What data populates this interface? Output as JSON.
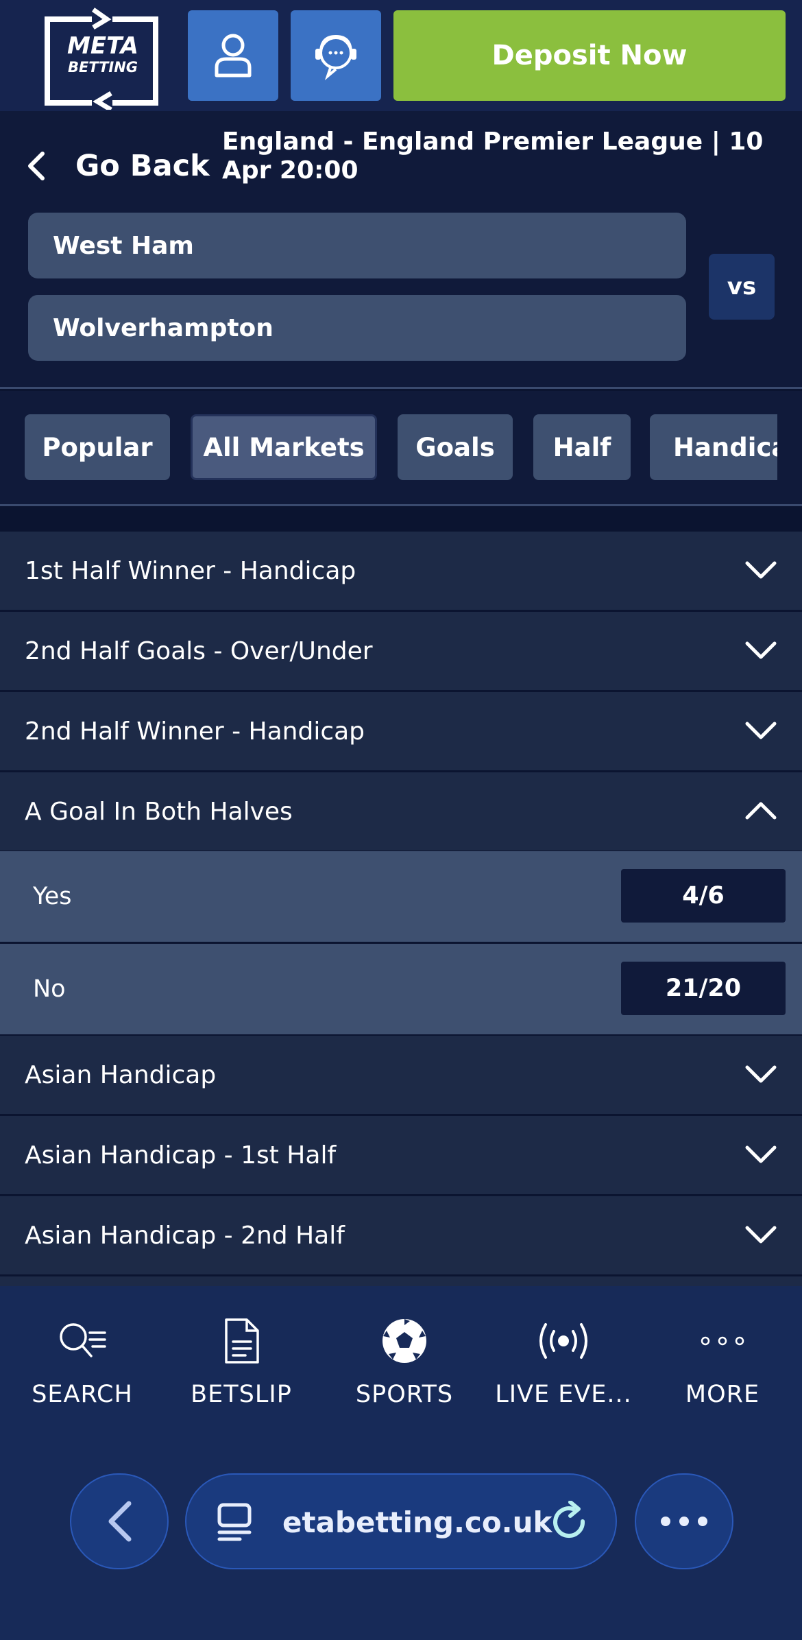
{
  "header": {
    "logo_line1": "META",
    "logo_line2": "BETTING",
    "user_icon": "user-icon",
    "support_icon": "support-chat-icon",
    "deposit_label": "Deposit Now",
    "brand_green": "#8bbf3e",
    "brand_blue": "#3b72c4"
  },
  "event": {
    "back_label": "Go Back",
    "title": "England - England Premier League | 10 Apr 20:00",
    "home_team": "West Ham",
    "away_team": "Wolverhampton",
    "vs_label": "vs"
  },
  "tabs": [
    {
      "label": "Popular",
      "active": false
    },
    {
      "label": "All Markets",
      "active": true
    },
    {
      "label": "Goals",
      "active": false
    },
    {
      "label": "Half",
      "active": false
    },
    {
      "label": "Handica",
      "active": false
    }
  ],
  "markets": [
    {
      "name": "1st Half Winner - Handicap",
      "expanded": false
    },
    {
      "name": "2nd Half Goals - Over/Under",
      "expanded": false
    },
    {
      "name": "2nd Half Winner - Handicap",
      "expanded": false
    },
    {
      "name": "A Goal In Both Halves",
      "expanded": true,
      "options": [
        {
          "label": "Yes",
          "odds": "4/6"
        },
        {
          "label": "No",
          "odds": "21/20"
        }
      ]
    },
    {
      "name": "Asian Handicap",
      "expanded": false
    },
    {
      "name": "Asian Handicap - 1st Half",
      "expanded": false
    },
    {
      "name": "Asian Handicap - 2nd Half",
      "expanded": false
    }
  ],
  "bottom_nav": [
    {
      "label": "SEARCH",
      "icon": "search-icon"
    },
    {
      "label": "BETSLIP",
      "icon": "betslip-icon"
    },
    {
      "label": "SPORTS",
      "icon": "soccer-ball-icon"
    },
    {
      "label": "LIVE EVE...",
      "icon": "live-broadcast-icon"
    },
    {
      "label": "MORE",
      "icon": "more-dots-icon"
    }
  ],
  "browser": {
    "url": "etabetting.co.uk",
    "back_icon": "back-arrow-icon",
    "reload_icon": "reload-icon",
    "menu_icon": "more-horizontal-icon"
  }
}
